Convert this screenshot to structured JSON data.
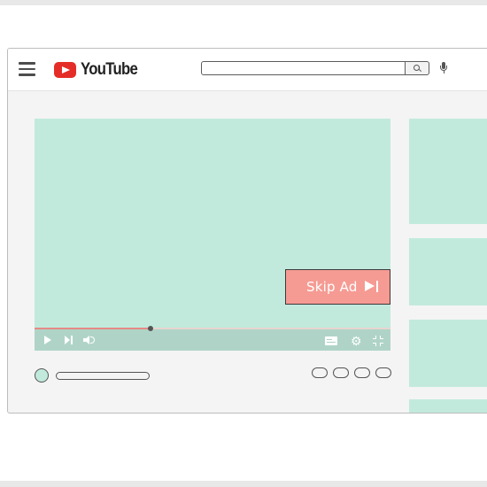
{
  "header": {
    "brand": "YouTube",
    "search": {
      "value": "",
      "placeholder": ""
    }
  },
  "player": {
    "progress": 0.325,
    "skip_ad_label": "Skip Ad"
  },
  "colors": {
    "accent_red": "#e52d27",
    "thumbnail_mint": "#c1eadd",
    "skip_ad_bg": "#f59b93",
    "controls_bar": "#afd4c7"
  },
  "icons": [
    "menu-icon",
    "youtube-play-icon",
    "search-icon",
    "microphone-icon",
    "play-icon",
    "next-icon",
    "volume-icon",
    "captions-icon",
    "settings-icon",
    "exit-fullscreen-icon",
    "skip-icon"
  ]
}
